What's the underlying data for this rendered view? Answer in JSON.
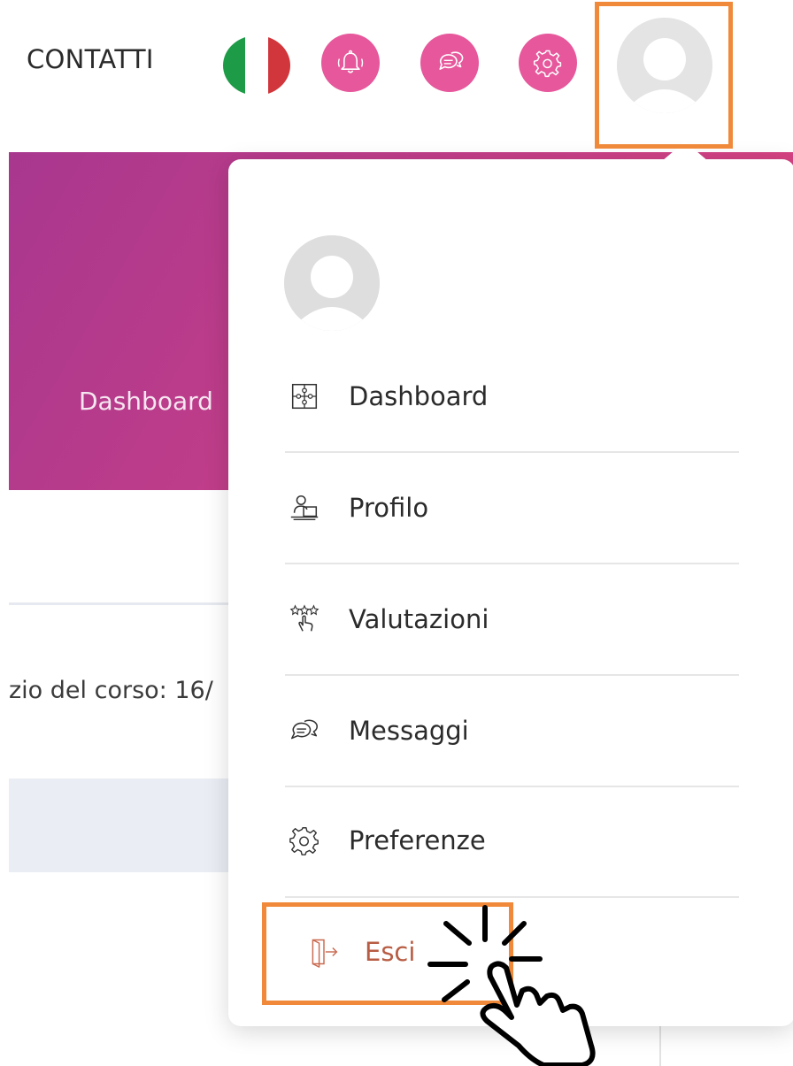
{
  "header": {
    "contacts_label": "CONTATTI",
    "language_flag_colors": [
      "#1e9b47",
      "#ffffff",
      "#d0363b"
    ],
    "buttons": [
      {
        "icon": "bell-icon"
      },
      {
        "icon": "chat-icon"
      },
      {
        "icon": "gear-icon"
      }
    ],
    "accent_color": "#e6579b",
    "avatar_icon": "user-avatar-icon"
  },
  "background_page": {
    "hero_dashboard_label": "Dashboard",
    "course_text": "zio del corso: 16/"
  },
  "user_menu": {
    "items": [
      {
        "label": "Dashboard",
        "icon": "puzzle-icon"
      },
      {
        "label": "Profilo",
        "icon": "profile-desk-icon"
      },
      {
        "label": "Valutazioni",
        "icon": "stars-hand-icon"
      },
      {
        "label": "Messaggi",
        "icon": "chat-bubbles-icon"
      },
      {
        "label": "Preferenze",
        "icon": "gear-icon"
      }
    ],
    "logout": {
      "label": "Esci",
      "icon": "logout-door-icon",
      "color": "#b85c43"
    }
  },
  "annotation": {
    "highlight_color": "#f08a3a",
    "cursor_icon": "pointing-hand-click-icon"
  }
}
